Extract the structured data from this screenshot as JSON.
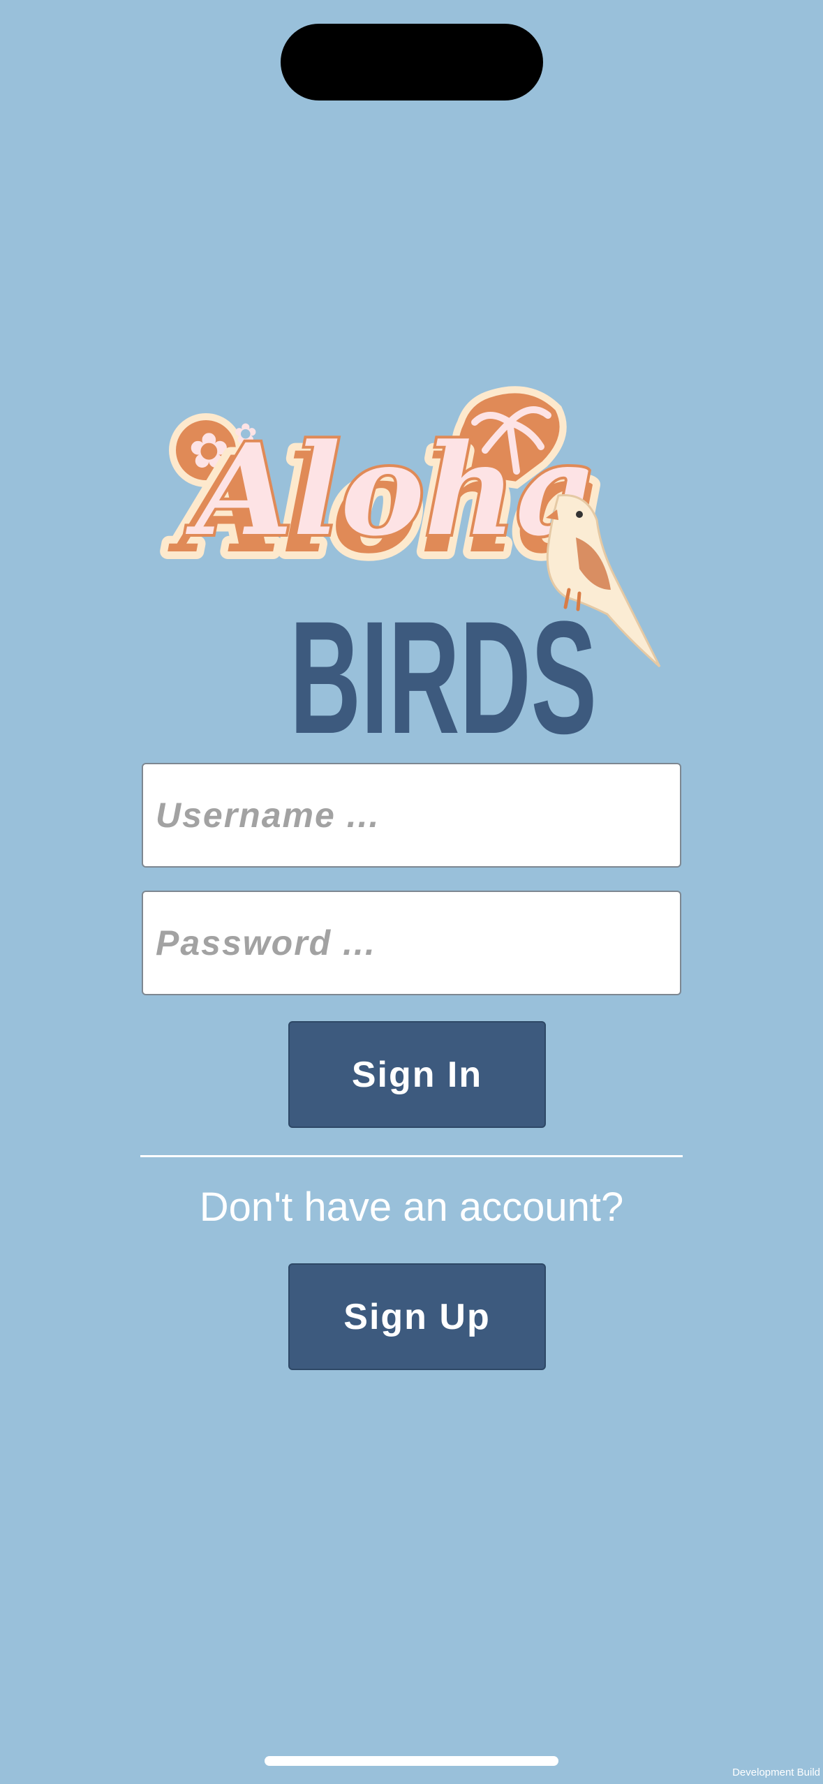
{
  "app": {
    "logo_script_text": "Aloha",
    "logo_block_text": "BIRDS"
  },
  "login": {
    "username_placeholder": "Username ...",
    "username_value": "",
    "password_placeholder": "Password ...",
    "password_value": "",
    "signin_label": "Sign In",
    "account_prompt": "Don't have an account?",
    "signup_label": "Sign Up"
  },
  "footer": {
    "build_label": "Development Build"
  },
  "colors": {
    "background": "#99c0da",
    "button": "#3d5a7e",
    "logo_orange": "#e08a57",
    "logo_cream": "#fde9cd",
    "logo_pink": "#fde3e5",
    "logo_blue": "#3d5a7e"
  },
  "icons": [
    "flower-icon",
    "palm-tree-icon",
    "bird-icon"
  ]
}
